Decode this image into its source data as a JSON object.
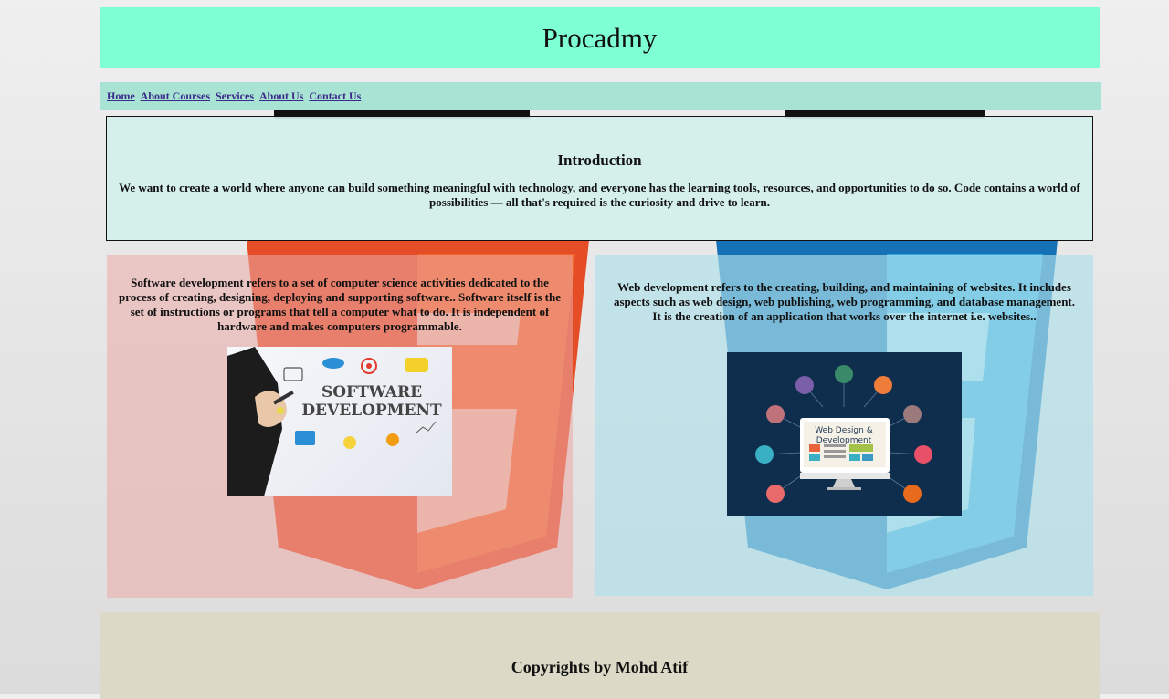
{
  "site": {
    "title": "Procadmy"
  },
  "nav": {
    "items": [
      "Home",
      "About Courses",
      "Services",
      "About Us",
      "Contact Us"
    ]
  },
  "intro": {
    "heading": "Introduction",
    "text": "We want to create a world where anyone can build something meaningful with technology, and everyone has the learning tools, resources, and opportunities to do so. Code contains a world of possibilities — all that's required is the curiosity and drive to learn."
  },
  "software": {
    "text": "Software development refers to a set of computer science activities dedicated to the process of creating, designing, deploying and supporting software.. Software itself is the set of instructions or programs that tell a computer what to do. It is independent of hardware and makes computers programmable.",
    "image_line1": "SOFTWARE",
    "image_line2": "DEVELOPMENT"
  },
  "web": {
    "text": "Web development refers to the creating, building, and maintaining of websites. It includes aspects such as web design, web publishing, web programming, and database management. It is the creation of an application that works over the internet i.e. websites..",
    "image_line1": "Web Design &",
    "image_line2": "Development"
  },
  "footer": {
    "text": "Copyrights by Mohd Atif"
  },
  "colors": {
    "header_bg": "#7fffd4",
    "nav_bg": "#a8e3d3",
    "footer_bg": "#dcdac6",
    "html5_orange": "#e44d26",
    "css3_blue": "#1572b6"
  }
}
